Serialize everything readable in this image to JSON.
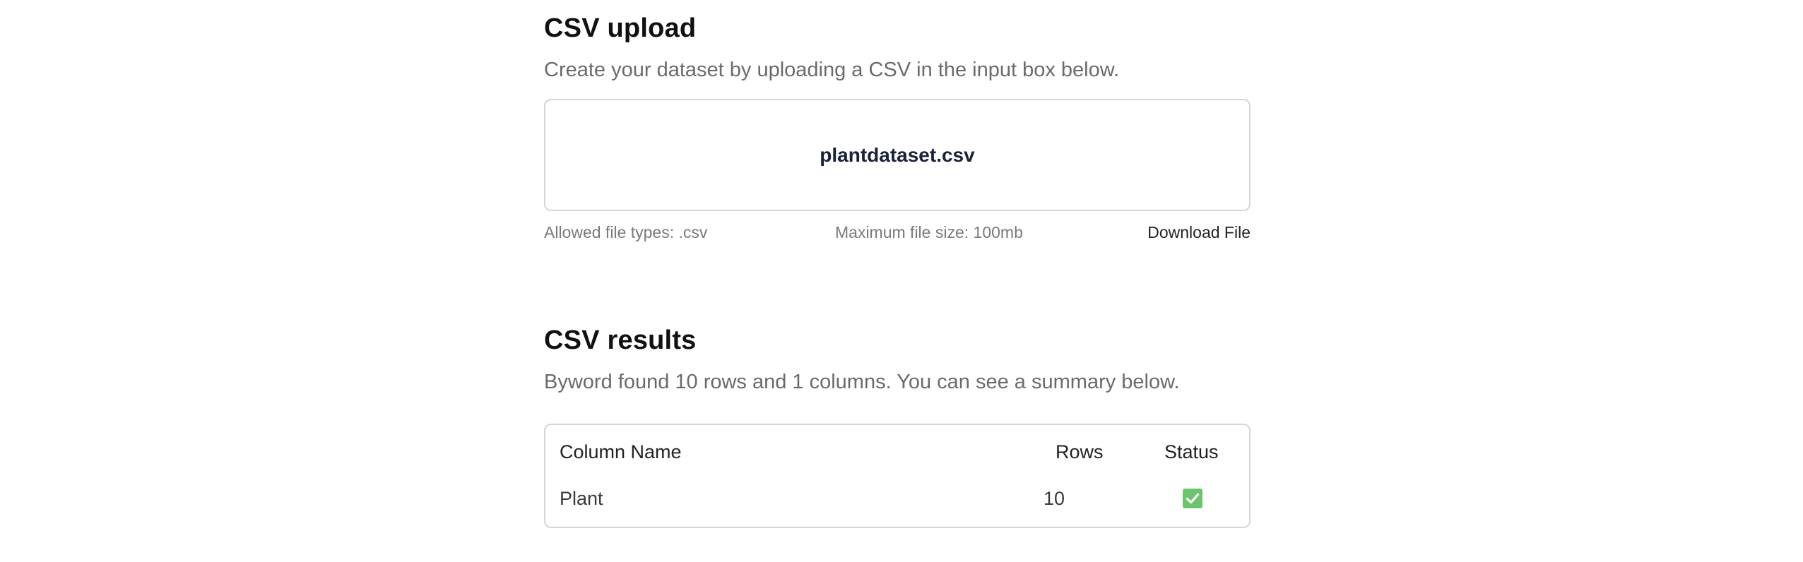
{
  "upload": {
    "title": "CSV upload",
    "description": "Create your dataset by uploading a CSV in the input box below.",
    "filename": "plantdataset.csv",
    "allowed_types": "Allowed file types: .csv",
    "max_size": "Maximum file size: 100mb",
    "download_label": "Download File"
  },
  "results": {
    "title": "CSV results",
    "description": "Byword found 10 rows and 1 columns. You can see a summary below.",
    "table": {
      "headers": [
        "Column Name",
        "Rows",
        "Status"
      ],
      "rows": [
        {
          "column_name": "Plant",
          "rows": "10",
          "status_icon": "check-icon"
        }
      ]
    }
  },
  "colors": {
    "status_ok": "#6cc46f",
    "border": "#d6d6d6",
    "muted_text": "#6b6b6b"
  }
}
